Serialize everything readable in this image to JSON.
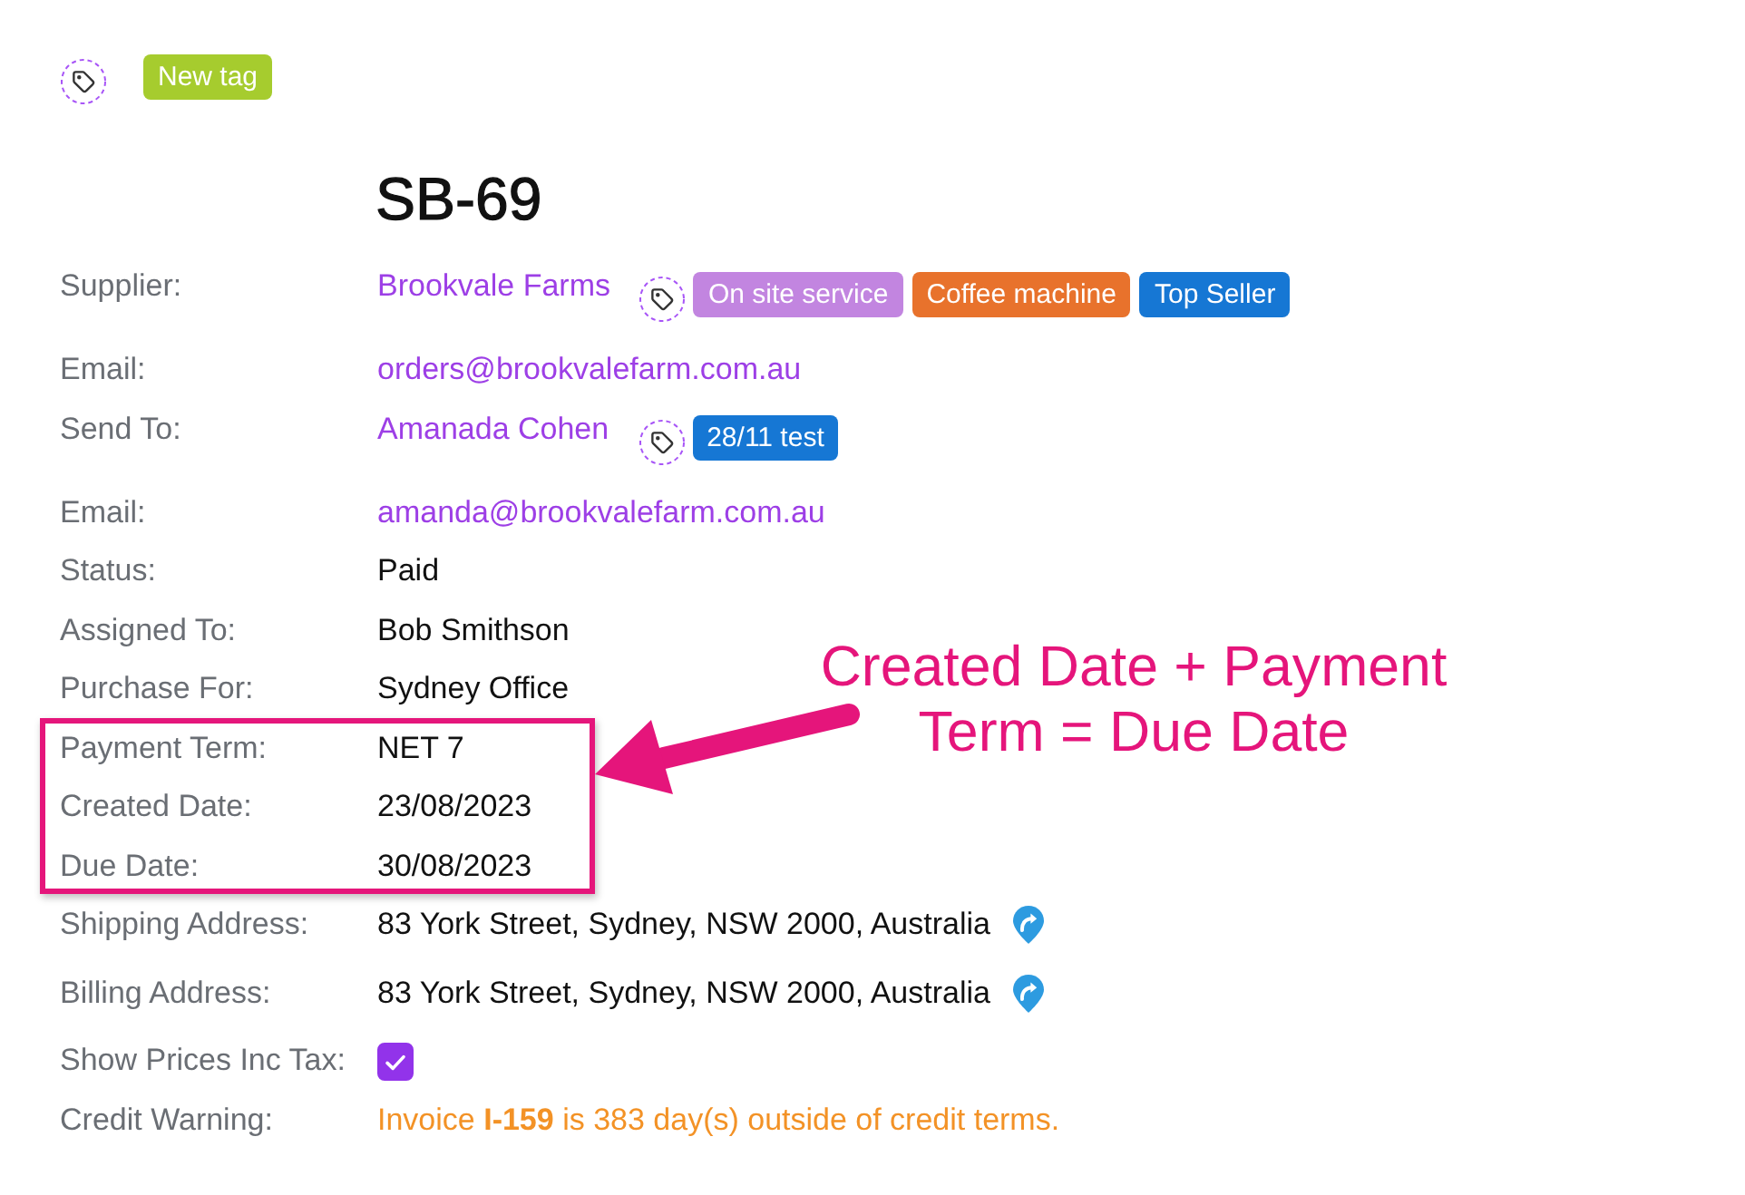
{
  "tag_bar": {
    "tags": [
      {
        "label": "New tag",
        "color": "#a6cc2e"
      }
    ]
  },
  "title": "SB-69",
  "fields": [
    {
      "kind": "link",
      "label": "Supplier:",
      "value": "Brookvale Farms",
      "tags": [
        {
          "label": "On site service",
          "color": "#c285e0"
        },
        {
          "label": "Coffee machine",
          "color": "#e8722c"
        },
        {
          "label": "Top Seller",
          "color": "#1677d4"
        }
      ],
      "highlighted": false
    },
    {
      "kind": "link",
      "label": "Email:",
      "value": "orders@brookvalefarm.com.au",
      "highlighted": false
    },
    {
      "kind": "link",
      "label": "Send To:",
      "value": "Amanada Cohen",
      "tags": [
        {
          "label": "28/11 test",
          "color": "#1677d4"
        }
      ],
      "highlighted": false
    },
    {
      "kind": "link",
      "label": "Email:",
      "value": "amanda@brookvalefarm.com.au",
      "highlighted": false
    },
    {
      "kind": "text",
      "label": "Status:",
      "value": "Paid",
      "highlighted": false
    },
    {
      "kind": "text",
      "label": "Assigned To:",
      "value": "Bob Smithson",
      "highlighted": false
    },
    {
      "kind": "text",
      "label": "Purchase For:",
      "value": "Sydney Office",
      "highlighted": false
    },
    {
      "kind": "text",
      "label": "Payment Term:",
      "value": "NET 7",
      "highlighted": true
    },
    {
      "kind": "text",
      "label": "Created Date:",
      "value": "23/08/2023",
      "highlighted": true
    },
    {
      "kind": "text",
      "label": "Due Date:",
      "value": "30/08/2023",
      "highlighted": true
    },
    {
      "kind": "address",
      "label": "Shipping Address:",
      "value": "83 York Street, Sydney, NSW 2000, Australia",
      "highlighted": false
    },
    {
      "kind": "address",
      "label": "Billing Address:",
      "value": "83 York Street, Sydney, NSW 2000, Australia",
      "highlighted": false
    },
    {
      "kind": "checkbox",
      "label": "Show Prices Inc Tax:",
      "checked": true,
      "highlighted": false
    },
    {
      "kind": "warning",
      "label": "Credit Warning:",
      "value": "Invoice **I-159** is 383 day(s) outside of credit terms.",
      "highlighted": false
    }
  ],
  "annotation": {
    "text": "Created Date + Payment Term = Due Date"
  }
}
